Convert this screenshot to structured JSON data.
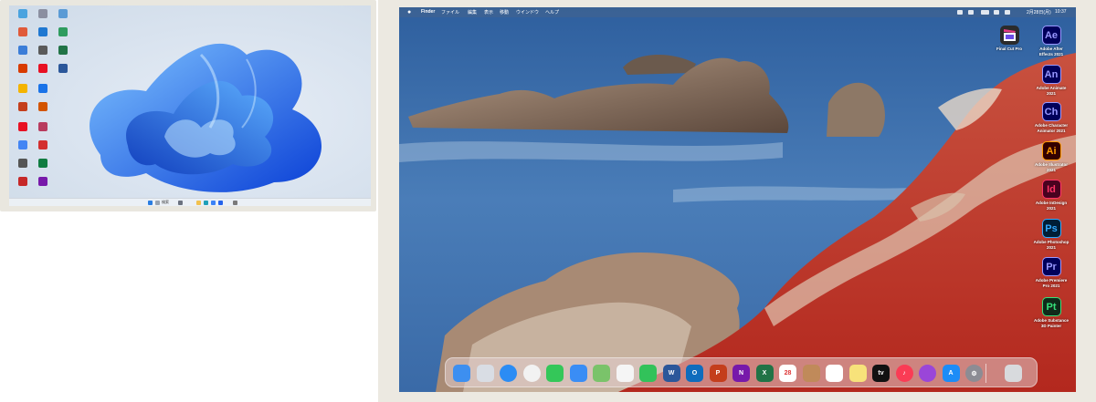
{
  "windows": {
    "taskbar": {
      "search_text": "検索"
    }
  },
  "mac": {
    "menubar": {
      "app_name": "Finder",
      "menus": [
        "ファイル",
        "編集",
        "表示",
        "移動",
        "ウインドウ",
        "ヘルプ"
      ],
      "date": "2月28日(月)",
      "time": "10:37"
    },
    "desktop_apps": [
      {
        "label": "Final Cut Pro",
        "abbr": "",
        "bg": "#2b2b2b",
        "fg": "#ffffff",
        "icon": "final-cut-pro-icon"
      },
      {
        "label": "Adobe After\nEffects 2021",
        "abbr": "Ae",
        "bg": "#00005b",
        "fg": "#9999ff",
        "icon": "after-effects-icon"
      },
      {
        "label": "Adobe Animate\n2021",
        "abbr": "An",
        "bg": "#00005b",
        "fg": "#9999ff",
        "icon": "animate-icon"
      },
      {
        "label": "Adobe Character\nAnimator 2021",
        "abbr": "Ch",
        "bg": "#00005b",
        "fg": "#9999ff",
        "icon": "character-animator-icon"
      },
      {
        "label": "Adobe Illustrator\n2021",
        "abbr": "Ai",
        "bg": "#330000",
        "fg": "#ff9a00",
        "icon": "illustrator-icon"
      },
      {
        "label": "Adobe InDesign\n2021",
        "abbr": "Id",
        "bg": "#49021f",
        "fg": "#ff3366",
        "icon": "indesign-icon"
      },
      {
        "label": "Adobe Photoshop\n2021",
        "abbr": "Ps",
        "bg": "#001e36",
        "fg": "#31a8ff",
        "icon": "photoshop-icon"
      },
      {
        "label": "Adobe Premiere\nPro 2021",
        "abbr": "Pr",
        "bg": "#00005b",
        "fg": "#9999ff",
        "icon": "premiere-pro-icon"
      },
      {
        "label": "Adobe Substance\n3D Painter",
        "abbr": "Pt",
        "bg": "#0f2a1a",
        "fg": "#36e07a",
        "icon": "substance-painter-icon"
      }
    ],
    "dock": [
      {
        "name": "finder-icon",
        "bg": "#3d8ff0",
        "text": ""
      },
      {
        "name": "launchpad-icon",
        "bg": "#d9dde4",
        "text": ""
      },
      {
        "name": "safari-icon",
        "bg": "#2b8cf4",
        "text": ""
      },
      {
        "name": "chrome-icon",
        "bg": "#f2f2f2",
        "text": ""
      },
      {
        "name": "messages-icon",
        "bg": "#34c759",
        "text": ""
      },
      {
        "name": "mail-icon",
        "bg": "#3a8df5",
        "text": ""
      },
      {
        "name": "maps-icon",
        "bg": "#7ac36a",
        "text": ""
      },
      {
        "name": "photos-icon",
        "bg": "#f5f5f5",
        "text": ""
      },
      {
        "name": "facetime-icon",
        "bg": "#32c25a",
        "text": ""
      },
      {
        "name": "word-icon",
        "bg": "#2b579a",
        "text": "W"
      },
      {
        "name": "outlook-icon",
        "bg": "#0f6cbd",
        "text": "O"
      },
      {
        "name": "powerpoint-icon",
        "bg": "#c43e1c",
        "text": "P"
      },
      {
        "name": "onenote-icon",
        "bg": "#7719aa",
        "text": "N"
      },
      {
        "name": "excel-icon",
        "bg": "#217346",
        "text": "X"
      },
      {
        "name": "calendar-icon",
        "bg": "#ffffff",
        "text": "28"
      },
      {
        "name": "contacts-icon",
        "bg": "#c08a5a",
        "text": ""
      },
      {
        "name": "reminders-icon",
        "bg": "#ffffff",
        "text": ""
      },
      {
        "name": "notes-icon",
        "bg": "#f7e27a",
        "text": ""
      },
      {
        "name": "apple-tv-icon",
        "bg": "#111111",
        "text": "tv"
      },
      {
        "name": "music-icon",
        "bg": "#fa3c55",
        "text": "♪"
      },
      {
        "name": "podcasts-icon",
        "bg": "#9a46d8",
        "text": ""
      },
      {
        "name": "app-store-icon",
        "bg": "#1c8cf7",
        "text": "A"
      },
      {
        "name": "system-preferences-icon",
        "bg": "#8c8c94",
        "text": "⚙"
      },
      {
        "name": "trash-icon",
        "bg": "#d8dadd",
        "text": ""
      }
    ]
  }
}
